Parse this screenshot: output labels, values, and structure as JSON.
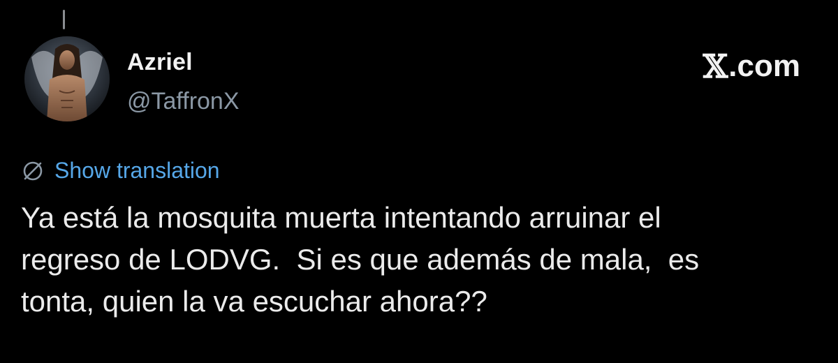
{
  "author": {
    "display_name": "Azriel",
    "handle": "@TaffronX"
  },
  "brand": {
    "logo_icon": "x-logo-icon",
    "label": ".com"
  },
  "translation": {
    "icon": "translate-globe-icon",
    "label": "Show translation",
    "color": "#56a7e8"
  },
  "tweet": {
    "text": "Ya está la mosquita muerta intentando arruinar el\nregreso de LODVG.  Si es que además de mala,  es\ntonta, quien la va escuchar ahora??"
  },
  "colors": {
    "background": "#000000",
    "secondary_text": "#8b98a5"
  }
}
